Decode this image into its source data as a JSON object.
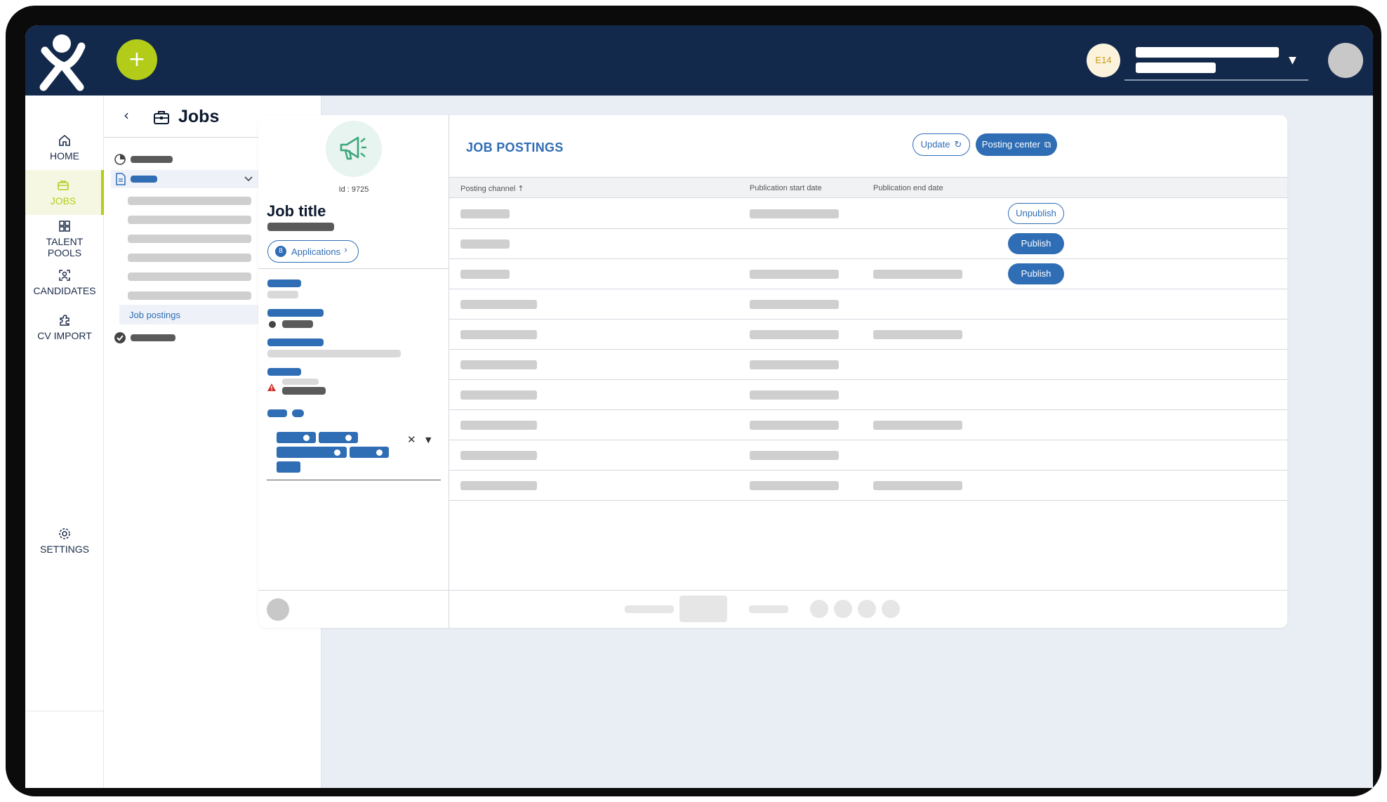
{
  "topbar": {
    "add_label": "+",
    "env_badge": "E14"
  },
  "leftnav": {
    "items": [
      {
        "label": "HOME",
        "icon": "home-icon"
      },
      {
        "label": "JOBS",
        "icon": "briefcase-icon",
        "active": true
      },
      {
        "label_line1": "TALENT",
        "label_line2": "POOLS",
        "icon": "grid-icon"
      },
      {
        "label": "CANDIDATES",
        "icon": "person-scan-icon"
      },
      {
        "label": "CV IMPORT",
        "icon": "puzzle-icon"
      }
    ],
    "settings_label": "SETTINGS"
  },
  "subnav": {
    "title": "Jobs",
    "active_link": "Job postings"
  },
  "job": {
    "id_text": "Id : 9725",
    "title": "Job title",
    "applications_count": "8",
    "applications_label": "Applications"
  },
  "postings": {
    "title": "JOB POSTINGS",
    "update_label": "Update",
    "posting_center_label": "Posting center",
    "columns": [
      "Posting channel",
      "Publication start date",
      "Publication end date"
    ],
    "sort_indicator": "↑",
    "rows": [
      {
        "has_start": true,
        "has_end": false,
        "action": "Unpublish"
      },
      {
        "has_start": false,
        "has_end": false,
        "action": "Publish"
      },
      {
        "has_start": true,
        "has_end": true,
        "action": "Publish"
      },
      {
        "has_start": true,
        "has_end": false,
        "action": ""
      },
      {
        "has_start": true,
        "has_end": true,
        "action": ""
      },
      {
        "has_start": true,
        "has_end": false,
        "action": ""
      },
      {
        "has_start": true,
        "has_end": false,
        "action": ""
      },
      {
        "has_start": true,
        "has_end": true,
        "action": ""
      },
      {
        "has_start": true,
        "has_end": false,
        "action": ""
      },
      {
        "has_start": true,
        "has_end": true,
        "action": ""
      }
    ]
  },
  "colors": {
    "navy": "#13294b",
    "accent_green": "#b3cc1a",
    "primary_blue": "#2f6db5",
    "megaphone_green": "#3aa679",
    "warning_red": "#d0312d"
  }
}
